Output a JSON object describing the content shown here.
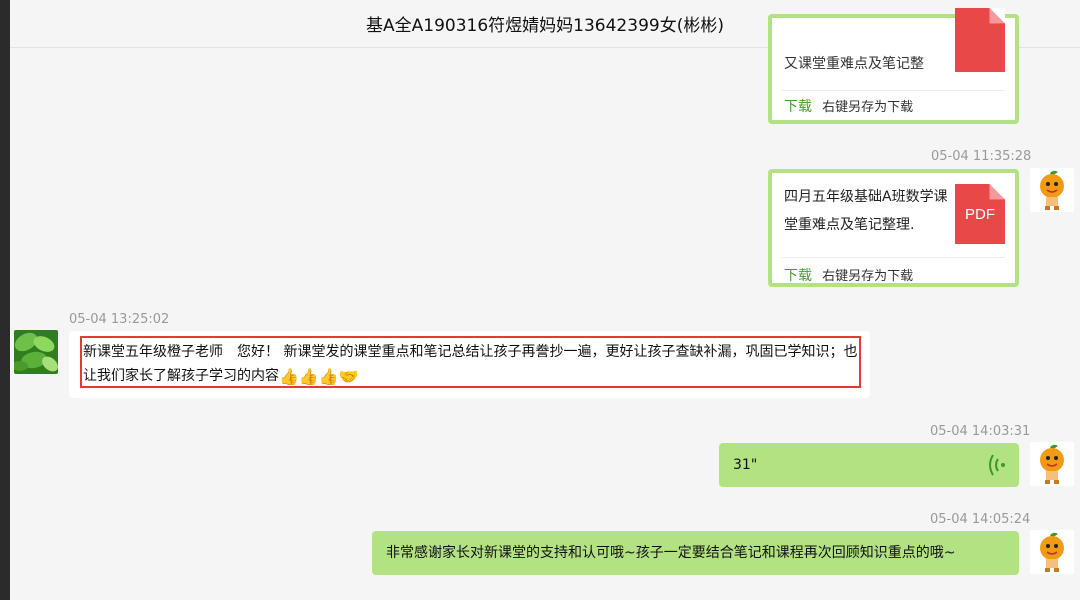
{
  "window": {
    "title": "基A全A190316符煜婧妈妈13642399女(彬彬)"
  },
  "messages": {
    "file1": {
      "filename_partial": "又课堂重难点及笔记整",
      "download_label": "下载",
      "saveas_label": "右键另存为下载"
    },
    "file2": {
      "timestamp": "05-04 11:35:28",
      "filename": "四月五年级基础A班数学课堂重难点及笔记整理.",
      "file_type": "PDF",
      "download_label": "下载",
      "saveas_label": "右键另存为下载"
    },
    "text1": {
      "timestamp": "05-04 13:25:02",
      "content": "新课堂五年级橙子老师　您好！ 新课堂发的课堂重点和笔记总结让孩子再誊抄一遍，更好让孩子查缺补漏，巩固已学知识；也让我们家长了解孩子学习的内容",
      "emojis": [
        "👍",
        "👍",
        "👍",
        "🤝"
      ]
    },
    "voice1": {
      "timestamp": "05-04 14:03:31",
      "duration": "31\""
    },
    "text2": {
      "timestamp": "05-04 14:05:24",
      "content": "非常感谢家长对新课堂的支持和认可哦~孩子一定要结合笔记和课程再次回顾知识重点的哦~"
    }
  },
  "colors": {
    "bubble_green": "#b2e281",
    "highlight_red": "#e53935",
    "download_green": "#4aa02c",
    "pdf_red": "#e84848"
  },
  "icons": {
    "self_avatar": "orange-mascot-avatar-icon",
    "other_avatar": "green-leaves-avatar-icon",
    "voice": "voice-wave-icon",
    "file": "pdf-file-icon"
  }
}
